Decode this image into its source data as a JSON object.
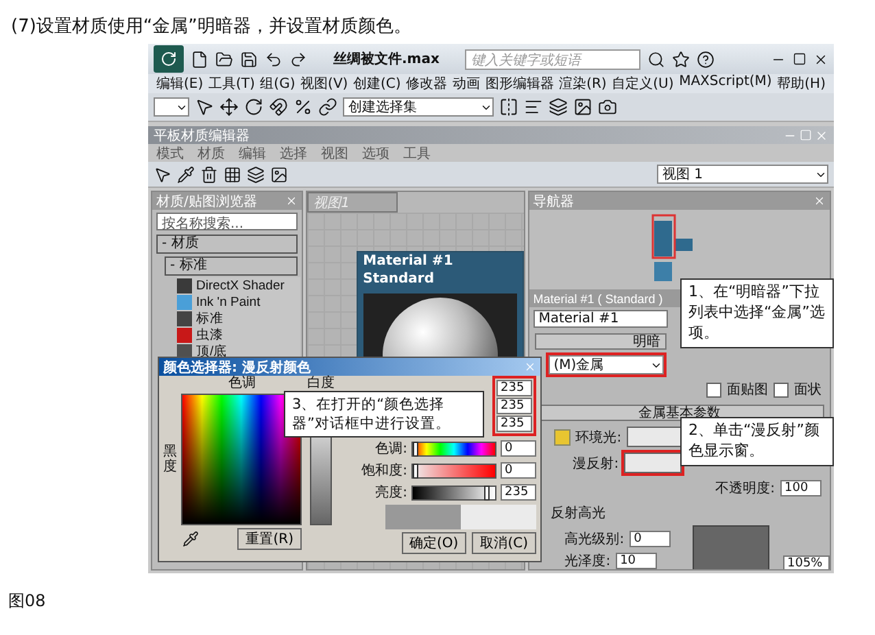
{
  "caption": "(7)设置材质使用“金属”明暗器，并设置材质颜色。",
  "app": {
    "title": "丝绸被文件.max",
    "search": {
      "placeholder": "键入关键字或短语"
    },
    "menu": [
      "编辑(E)",
      "工具(T)",
      "组(G)",
      "视图(V)",
      "创建(C)",
      "修改器",
      "动画",
      "图形编辑器",
      "渲染(R)",
      "自定义(U)",
      "MAXScript(M)",
      "帮助(H)"
    ],
    "selection_set": "创建选择集"
  },
  "editor": {
    "title": "平板材质编辑器",
    "menu": [
      "模式",
      "材质",
      "编辑",
      "选择",
      "视图",
      "选项",
      "工具"
    ],
    "view_select": "视图 1",
    "browser": {
      "title": "材质/贴图浏览器",
      "search": {
        "placeholder": "按名称搜索..."
      },
      "tree": [
        {
          "label": "- 材质",
          "children": [
            {
              "label": "- 标准",
              "children": [
                {
                  "label": "DirectX Shader",
                  "color": "#3a3a3a"
                },
                {
                  "label": "Ink 'n Paint",
                  "color": "#4a9fd8"
                },
                {
                  "label": "标准",
                  "color": "#444444"
                },
                {
                  "label": "虫漆",
                  "color": "#c81818"
                },
                {
                  "label": "顶/底",
                  "color": "#505050"
                }
              ]
            }
          ]
        }
      ]
    },
    "view": {
      "tab": "视图1",
      "node": {
        "title": "Material #1",
        "type": "Standard"
      }
    },
    "navigator": {
      "title": "导航器"
    },
    "params": {
      "title": "Material #1 ( Standard )",
      "name": "Material #1",
      "shader_rollout": "明暗",
      "shader": "(M)金属",
      "options": [
        {
          "label": "面贴图",
          "checked": false
        },
        {
          "label": "面状",
          "checked": false
        }
      ],
      "basic_rollout": "金属基本参数",
      "ambient_label": "环境光:",
      "diffuse_label": "漫反射:",
      "opacity_label": "不透明度:",
      "opacity": "100",
      "specular": {
        "title": "反射高光",
        "level_label": "高光级别:",
        "level": "0",
        "gloss_label": "光泽度:",
        "gloss": "10"
      },
      "zoom": "105%"
    }
  },
  "color_dialog": {
    "title": "颜色选择器: 漫反射颜色",
    "hue_label": "色调",
    "whiteness_label": "白度",
    "blackness_label": "黑度",
    "rgb": [
      "235",
      "235",
      "235"
    ],
    "hsv": [
      {
        "label": "色调:",
        "value": "0",
        "level": 0
      },
      {
        "label": "饱和度:",
        "value": "0",
        "level": 0
      },
      {
        "label": "亮度:",
        "value": "235",
        "level": 0.92
      }
    ],
    "reset": "重置(R)",
    "ok": "确定(O)",
    "cancel": "取消(C)"
  },
  "callouts": [
    {
      "text": "1、在“明暗器”下拉列表中选择“金属”选项。"
    },
    {
      "text": "2、单击“漫反射”颜色显示窗。"
    },
    {
      "text": "3、在打开的“颜色选择器”对话框中进行设置。"
    }
  ],
  "figure_label": "图08"
}
